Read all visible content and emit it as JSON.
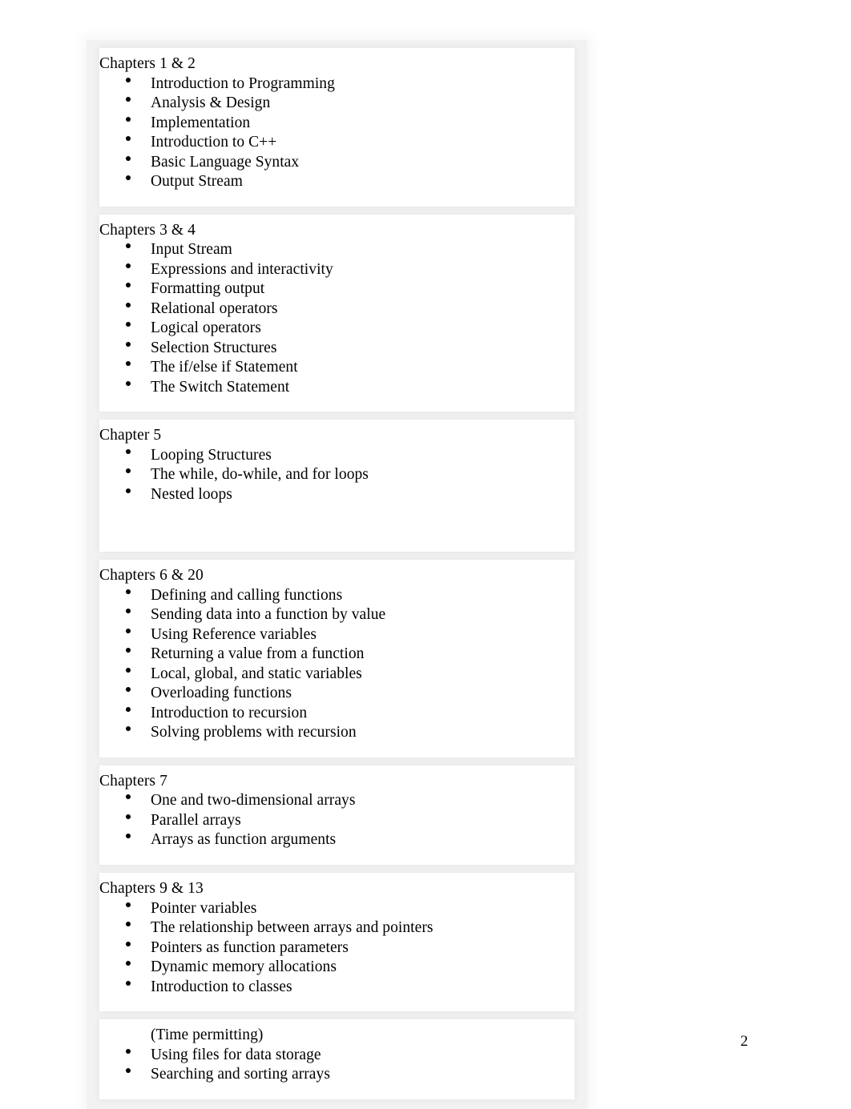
{
  "document": {
    "page_number": "2",
    "sections": [
      {
        "heading": "Chapters 1 & 2",
        "items": [
          {
            "text": "Introduction to Programming",
            "bulleted": true
          },
          {
            "text": "Analysis & Design",
            "bulleted": true
          },
          {
            "text": "Implementation",
            "bulleted": true
          },
          {
            "text": "Introduction to C++",
            "bulleted": true
          },
          {
            "text": "Basic Language Syntax",
            "bulleted": true
          },
          {
            "text": "Output Stream",
            "bulleted": true
          }
        ],
        "trailing_space": "small"
      },
      {
        "heading": "Chapters 3 & 4",
        "items": [
          {
            "text": "Input Stream",
            "bulleted": true
          },
          {
            "text": "Expressions and interactivity",
            "bulleted": true
          },
          {
            "text": "Formatting output",
            "bulleted": true
          },
          {
            "text": "Relational operators",
            "bulleted": true
          },
          {
            "text": "Logical operators",
            "bulleted": true
          },
          {
            "text": "Selection Structures",
            "bulleted": true
          },
          {
            "text": "The if/else if Statement",
            "bulleted": true
          },
          {
            "text": "The Switch Statement",
            "bulleted": true
          }
        ],
        "trailing_space": "small"
      },
      {
        "heading": "Chapter 5",
        "items": [
          {
            "text": "Looping Structures",
            "bulleted": true
          },
          {
            "text": "The while, do-while, and for loops",
            "bulleted": true
          },
          {
            "text": "Nested loops",
            "bulleted": true
          }
        ],
        "trailing_space": "large"
      },
      {
        "heading": "Chapters 6 & 20",
        "items": [
          {
            "text": "Defining and calling functions",
            "bulleted": true
          },
          {
            "text": "Sending data into a function by value",
            "bulleted": true
          },
          {
            "text": "Using Reference variables",
            "bulleted": true
          },
          {
            "text": "Returning a value from a function",
            "bulleted": true
          },
          {
            "text": "Local, global, and static variables",
            "bulleted": true
          },
          {
            "text": "Overloading functions",
            "bulleted": true
          },
          {
            "text": "Introduction to recursion",
            "bulleted": true
          },
          {
            "text": "Solving problems with recursion",
            "bulleted": true
          }
        ],
        "trailing_space": "small"
      },
      {
        "heading": "Chapters 7",
        "items": [
          {
            "text": "One and two-dimensional arrays",
            "bulleted": true
          },
          {
            "text": "Parallel arrays",
            "bulleted": true
          },
          {
            "text": "Arrays as function arguments",
            "bulleted": true
          }
        ],
        "trailing_space": "small"
      },
      {
        "heading": "Chapters 9 & 13",
        "items": [
          {
            "text": "Pointer variables",
            "bulleted": true
          },
          {
            "text": "The relationship between arrays and pointers",
            "bulleted": true
          },
          {
            "text": "Pointers as function parameters",
            "bulleted": true
          },
          {
            "text": "Dynamic memory allocations",
            "bulleted": true
          },
          {
            "text": "Introduction to classes",
            "bulleted": true
          }
        ],
        "trailing_space": "small"
      },
      {
        "heading": "",
        "items": [
          {
            "text": "(Time permitting)",
            "bulleted": false
          },
          {
            "text": "Using files for data storage",
            "bulleted": true
          },
          {
            "text": "Searching and sorting arrays",
            "bulleted": true
          }
        ],
        "trailing_space": "small"
      }
    ]
  },
  "colors": {
    "page_background": "#ffffff",
    "block_background": "#ffffff",
    "separator": "#f2f2f2",
    "text": "#000000"
  }
}
